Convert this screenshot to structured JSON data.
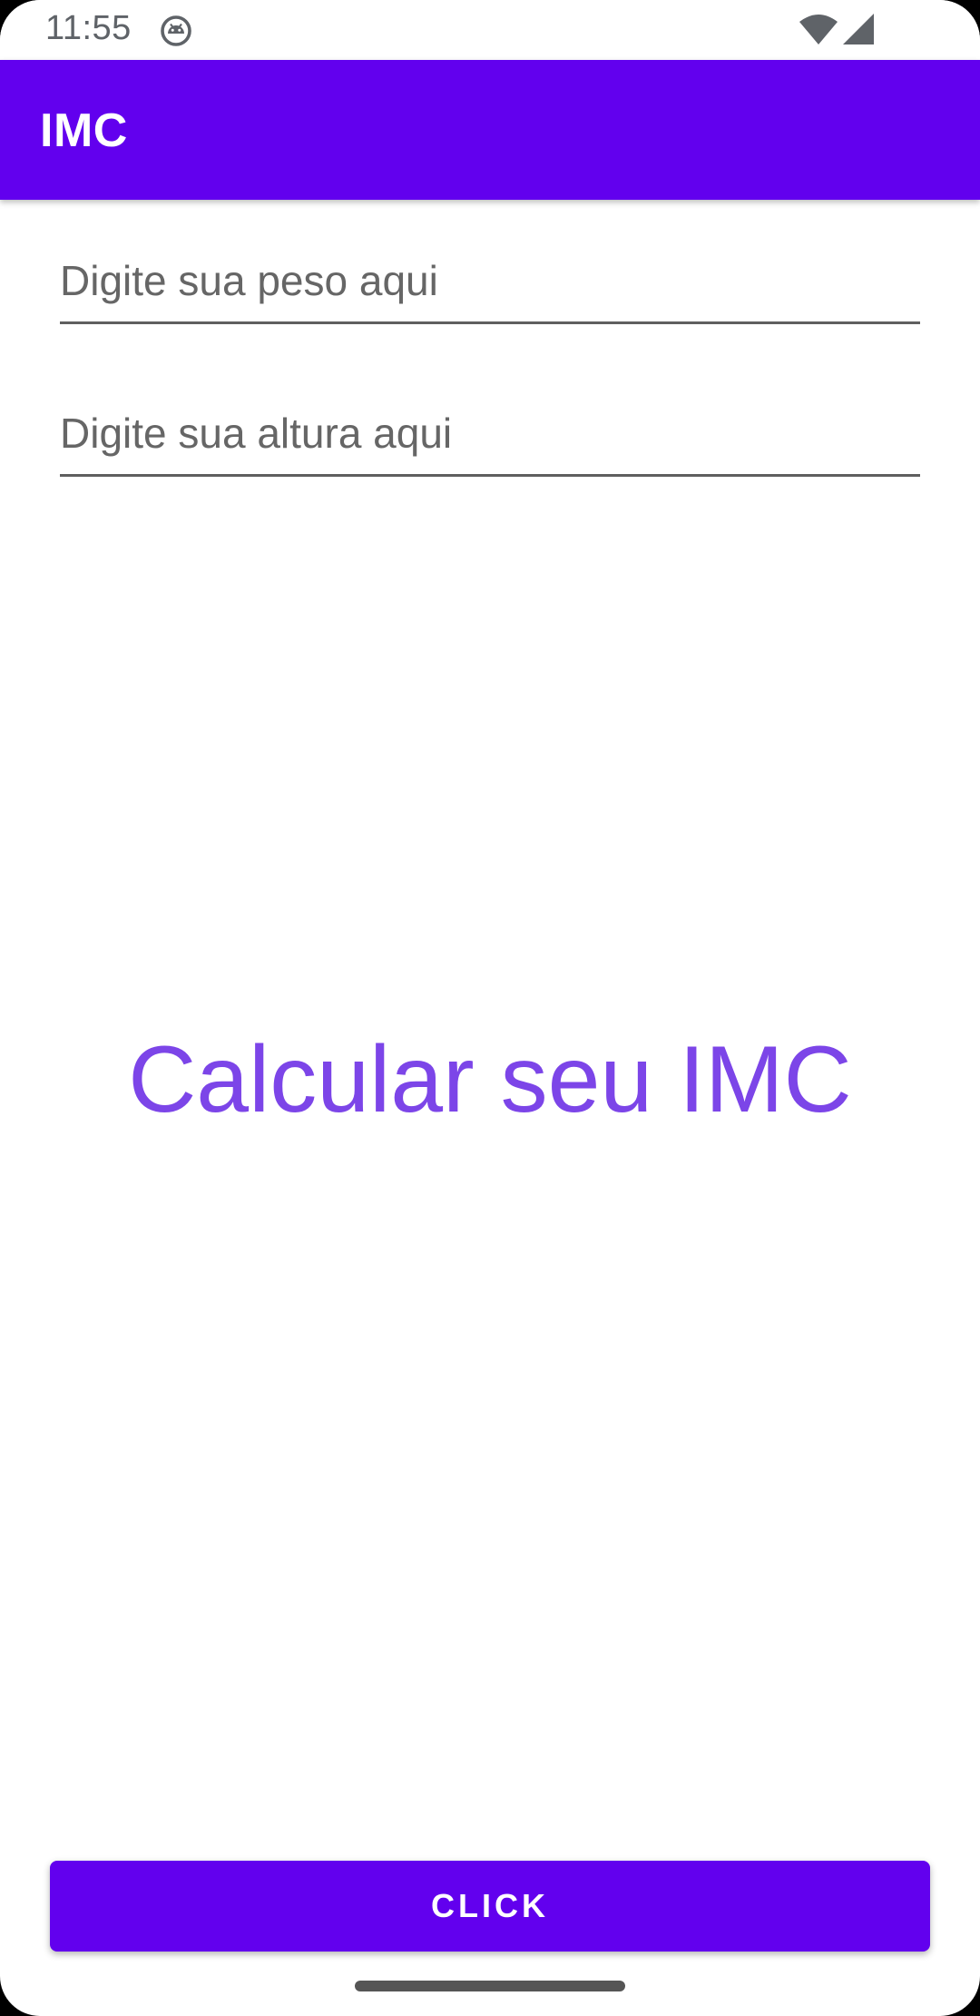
{
  "status_bar": {
    "time": "11:55",
    "notification_icon": "android-robot-icon",
    "wifi_icon": "wifi-icon",
    "signal_icon": "cell-signal-icon"
  },
  "app_bar": {
    "title": "IMC",
    "color": "#6200ee"
  },
  "form": {
    "weight_placeholder": "Digite sua peso aqui",
    "weight_value": "",
    "height_placeholder": "Digite sua altura aqui",
    "height_value": ""
  },
  "result": {
    "text": "Calcular seu IMC",
    "color": "#7c45e8"
  },
  "action": {
    "button_label": "CLICK"
  }
}
